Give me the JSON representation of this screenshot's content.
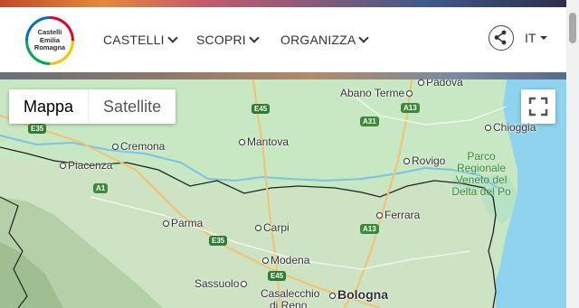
{
  "header": {
    "logo": {
      "line1": "Castelli",
      "line2": "Emilia",
      "line3": "Romagna"
    },
    "nav": [
      {
        "label": "CASTELLI"
      },
      {
        "label": "SCOPRI"
      },
      {
        "label": "ORGANIZZA"
      }
    ],
    "language": "IT",
    "share_icon": "share-icon"
  },
  "map": {
    "toggle": {
      "map_label": "Mappa",
      "satellite_label": "Satellite",
      "selected": "Mappa"
    },
    "fullscreen_icon": "fullscreen-icon",
    "cities": [
      {
        "name": "Padova",
        "size": "normal"
      },
      {
        "name": "Abano Terme",
        "size": "normal"
      },
      {
        "name": "Chioggia",
        "size": "normal"
      },
      {
        "name": "Cremona",
        "size": "normal"
      },
      {
        "name": "Mantova",
        "size": "normal"
      },
      {
        "name": "Piacenza",
        "size": "normal"
      },
      {
        "name": "Rovigo",
        "size": "normal"
      },
      {
        "name": "Parma",
        "size": "normal"
      },
      {
        "name": "Carpi",
        "size": "normal"
      },
      {
        "name": "Ferrara",
        "size": "normal"
      },
      {
        "name": "Modena",
        "size": "normal"
      },
      {
        "name": "Sassuolo",
        "size": "normal"
      },
      {
        "name": "Casalecchio",
        "size": "normal"
      },
      {
        "name": "di Reno",
        "size": "normal"
      },
      {
        "name": "Bologna",
        "size": "big"
      }
    ],
    "park_label": "Parco Regionale Veneto del Delta del Po",
    "roads": [
      "E45",
      "A31",
      "A13",
      "E35",
      "A1",
      "E35",
      "A13",
      "E45"
    ]
  },
  "colors": {
    "map_land": "#c7e8c2",
    "water": "#8fd3ef",
    "road_badge": "#2e7d32"
  }
}
